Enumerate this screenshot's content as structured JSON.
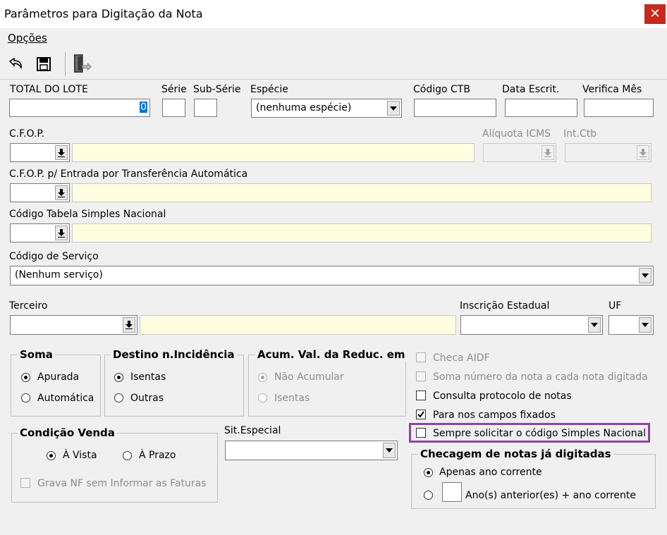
{
  "window": {
    "title": "Parâmetros para Digitação da Nota",
    "close_label": "✕"
  },
  "menu": {
    "opcoes": "Opções"
  },
  "toolbar": {
    "undo_icon": "undo-icon",
    "save_icon": "save-icon",
    "exit_icon": "exit-door-icon"
  },
  "row1": {
    "total_lote_label": "TOTAL DO LOTE",
    "total_lote_value": "0",
    "serie_label": "Série",
    "subserie_label": "Sub-Série",
    "especie_label": "Espécie",
    "especie_value": "(nenhuma espécie)",
    "codigo_ctb_label": "Código CTB",
    "data_escrit_label": "Data Escrit.",
    "verifica_mes_label": "Verifica Mês"
  },
  "cfop": {
    "label": "C.F.O.P.",
    "aliquota_label": "Alíquota ICMS",
    "intctb_label": "Int.Ctb"
  },
  "cfop_transf": {
    "label": "C.F.O.P.  p/ Entrada por Transferência Automática"
  },
  "simples": {
    "label": "Código Tabela Simples Nacional"
  },
  "servico": {
    "label": "Código de Serviço",
    "value": "(Nenhum serviço)"
  },
  "terceiro": {
    "label": "Terceiro",
    "ie_label": "Inscrição Estadual",
    "uf_label": "UF"
  },
  "soma": {
    "title": "Soma",
    "apurada": "Apurada",
    "automatica": "Automática"
  },
  "destino": {
    "title": "Destino n.Incidência",
    "isentas": "Isentas",
    "outras": "Outras"
  },
  "acum": {
    "title": "Acum. Val. da Reduc. em",
    "nao_acumular": "Não Acumular",
    "isentas": "Isentas"
  },
  "checks": {
    "checa_aidf": "Checa AIDF",
    "soma_numero": "Soma número da nota a cada nota digitada",
    "consulta_protocolo": "Consulta protocolo de notas",
    "para_campos_fixados": "Para nos campos fixados",
    "sempre_solicitar": "Sempre solicitar o código Simples Nacional"
  },
  "condicao": {
    "title": "Condição Venda",
    "a_vista": "À Vista",
    "a_prazo": "À Prazo",
    "grava_nf": "Grava NF sem Informar as Faturas"
  },
  "sit_especial": {
    "label": "Sit.Especial"
  },
  "checagem": {
    "title": "Checagem de notas já digitadas",
    "apenas": "Apenas ano corrente",
    "anteriores": "Ano(s) anterior(es) + ano corrente"
  }
}
